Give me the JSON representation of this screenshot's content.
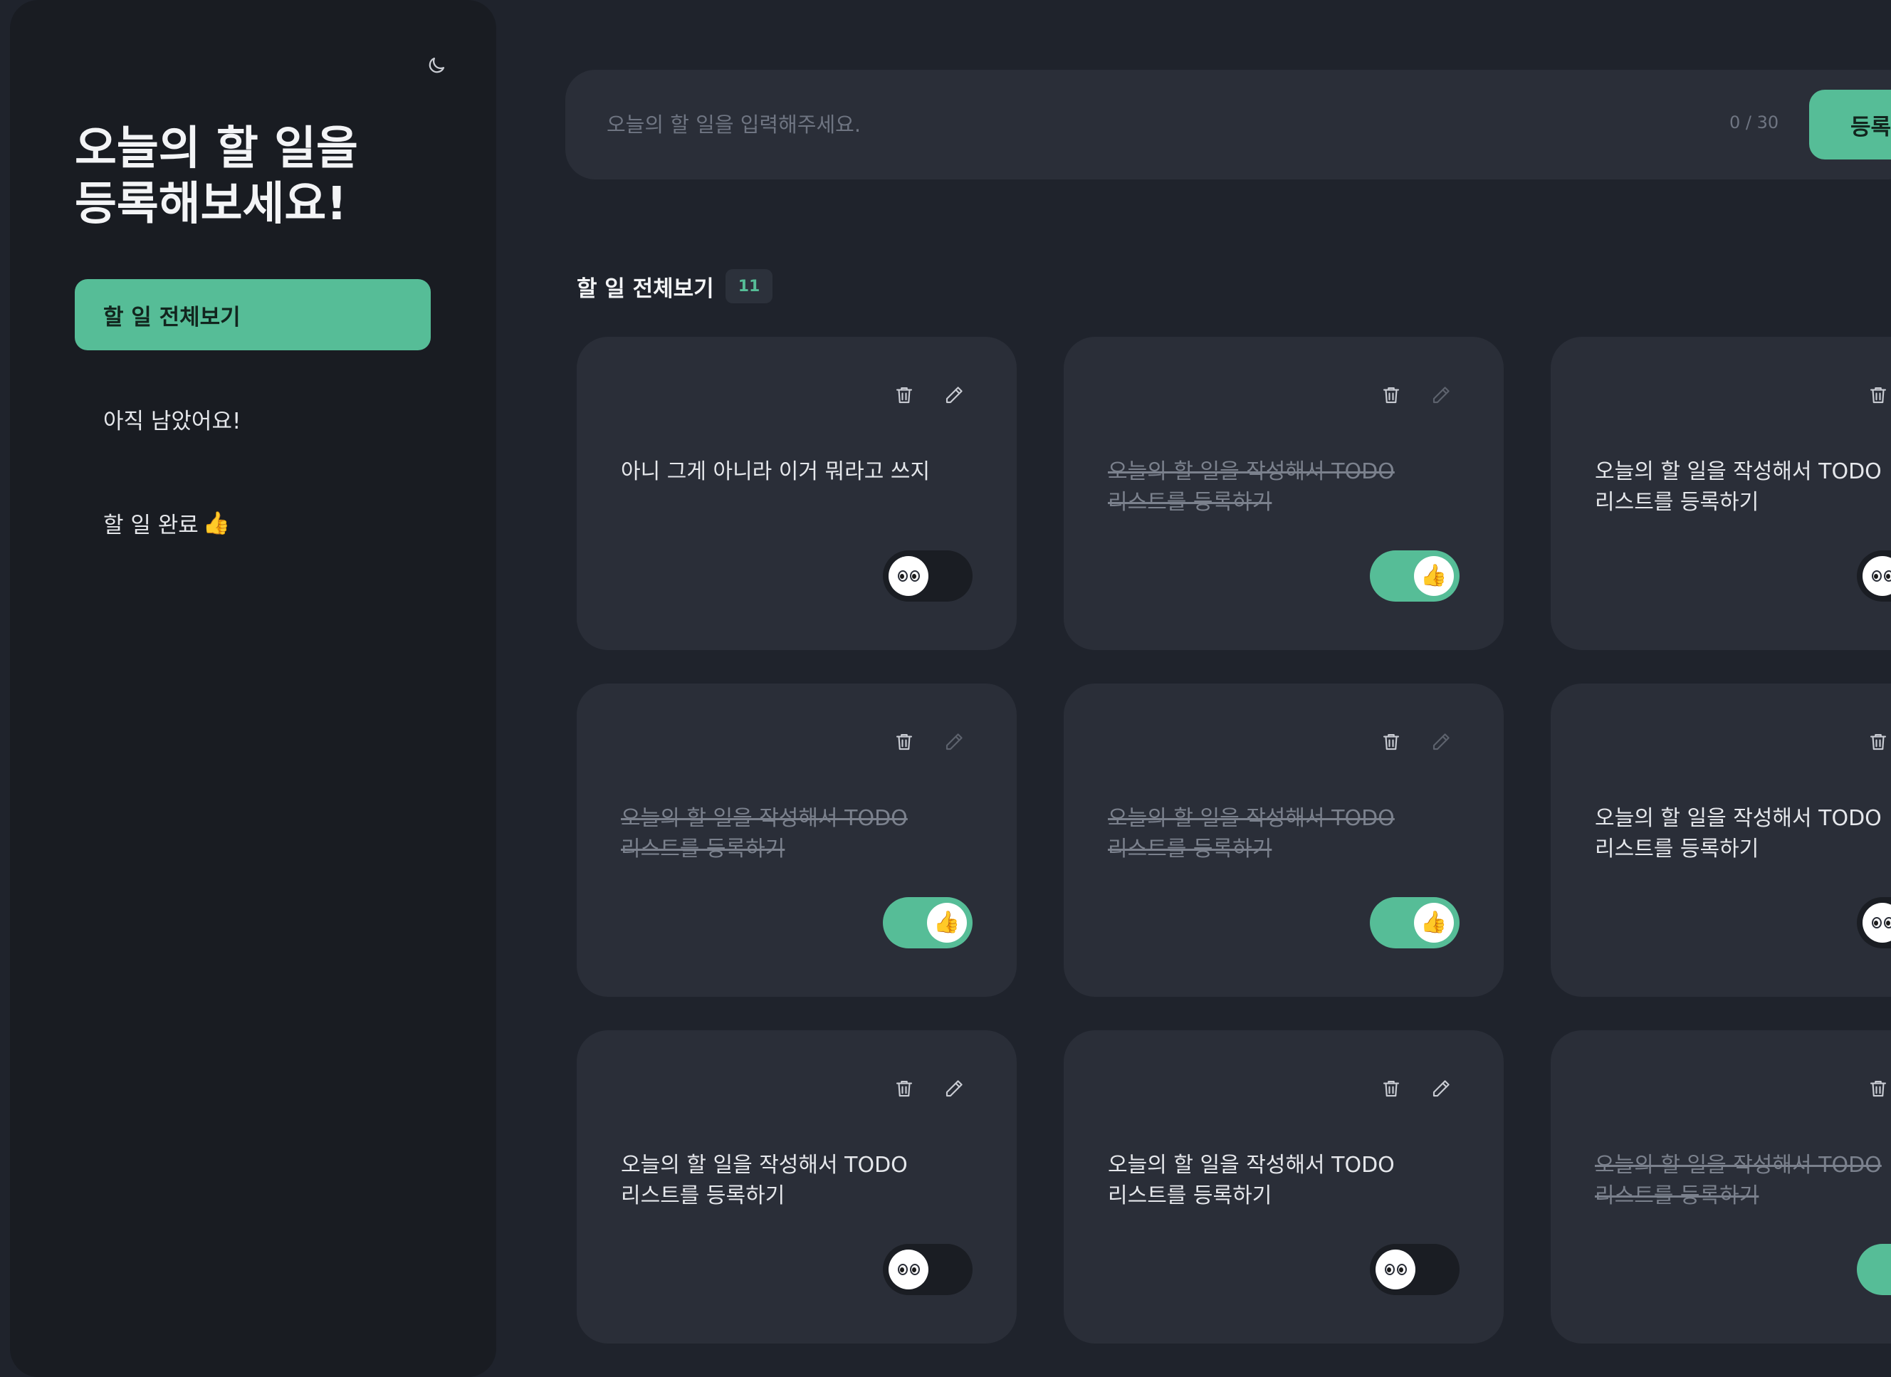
{
  "sidebar": {
    "title_line1": "오늘의 할 일을",
    "title_line2": "등록해보세요!",
    "items": [
      {
        "label": "할 일 전체보기",
        "emoji": ""
      },
      {
        "label": "아직 남았어요!",
        "emoji": ""
      },
      {
        "label": "할 일 완료",
        "emoji": "👍"
      }
    ]
  },
  "input": {
    "placeholder": "오늘의 할 일을 입력해주세요.",
    "value": "",
    "counter": "0 / 30",
    "submit_label": "등록"
  },
  "section": {
    "title": "할 일 전체보기",
    "count": "11"
  },
  "colors": {
    "accent": "#56bd97",
    "background": "#1f232c",
    "sidebar": "#191c22",
    "card": "#2a2e38"
  },
  "todos": [
    {
      "text": "아니 그게 아니라 이거 뭐라고 쓰지",
      "completed": false,
      "knob": "eyes"
    },
    {
      "text": "오늘의 할 일을 작성해서 TODO 리스트를 등록하기",
      "completed": true,
      "knob": "👍"
    },
    {
      "text": "오늘의 할 일을 작성해서 TODO 리스트를 등록하기",
      "completed": false,
      "knob": "eyes"
    },
    {
      "text": "오늘의 할 일을 작성해서 TODO 리스트를 등록하기",
      "completed": true,
      "knob": "👍"
    },
    {
      "text": "오늘의 할 일을 작성해서 TODO 리스트를 등록하기",
      "completed": true,
      "knob": "👍"
    },
    {
      "text": "오늘의 할 일을 작성해서 TODO 리스트를 등록하기",
      "completed": false,
      "knob": "eyes"
    },
    {
      "text": "오늘의 할 일을 작성해서 TODO 리스트를 등록하기",
      "completed": false,
      "knob": "eyes"
    },
    {
      "text": "오늘의 할 일을 작성해서 TODO 리스트를 등록하기",
      "completed": false,
      "knob": "eyes"
    },
    {
      "text": "오늘의 할 일을 작성해서 TODO 리스트를 등록하기",
      "completed": true,
      "knob": "👍"
    }
  ],
  "icons": {
    "theme": "moon-icon",
    "delete": "trash-icon",
    "edit": "pencil-icon"
  }
}
